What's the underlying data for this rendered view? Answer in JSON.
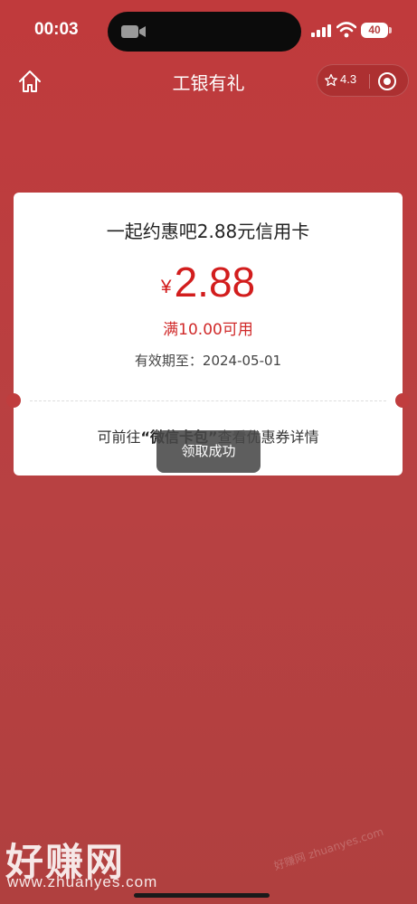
{
  "status_bar": {
    "time": "00:03",
    "battery": "40"
  },
  "nav": {
    "title": "工银有礼",
    "rating": "4.3"
  },
  "coupon": {
    "title": "一起约惠吧2.88元信用卡",
    "currency": "¥",
    "amount": "2.88",
    "threshold": "满10.00可用",
    "validity": "有效期至：2024-05-01",
    "hint_prefix": "可前往",
    "hint_strong": "“微信卡包”",
    "hint_suffix": "查看优惠券详情"
  },
  "toast": {
    "message": "领取成功"
  },
  "watermark": {
    "logo": "好赚网",
    "url": "www.zhuanyes.com",
    "faint": "好赚网 zhuanyes.com"
  },
  "colors": {
    "background": "#c03a3c",
    "price_red": "#d21d1d",
    "card": "#ffffff"
  },
  "icons": {
    "home": "home-icon",
    "star": "star-icon",
    "close": "close-icon",
    "camera": "camera-icon",
    "signal": "signal-icon",
    "wifi": "wifi-icon"
  }
}
